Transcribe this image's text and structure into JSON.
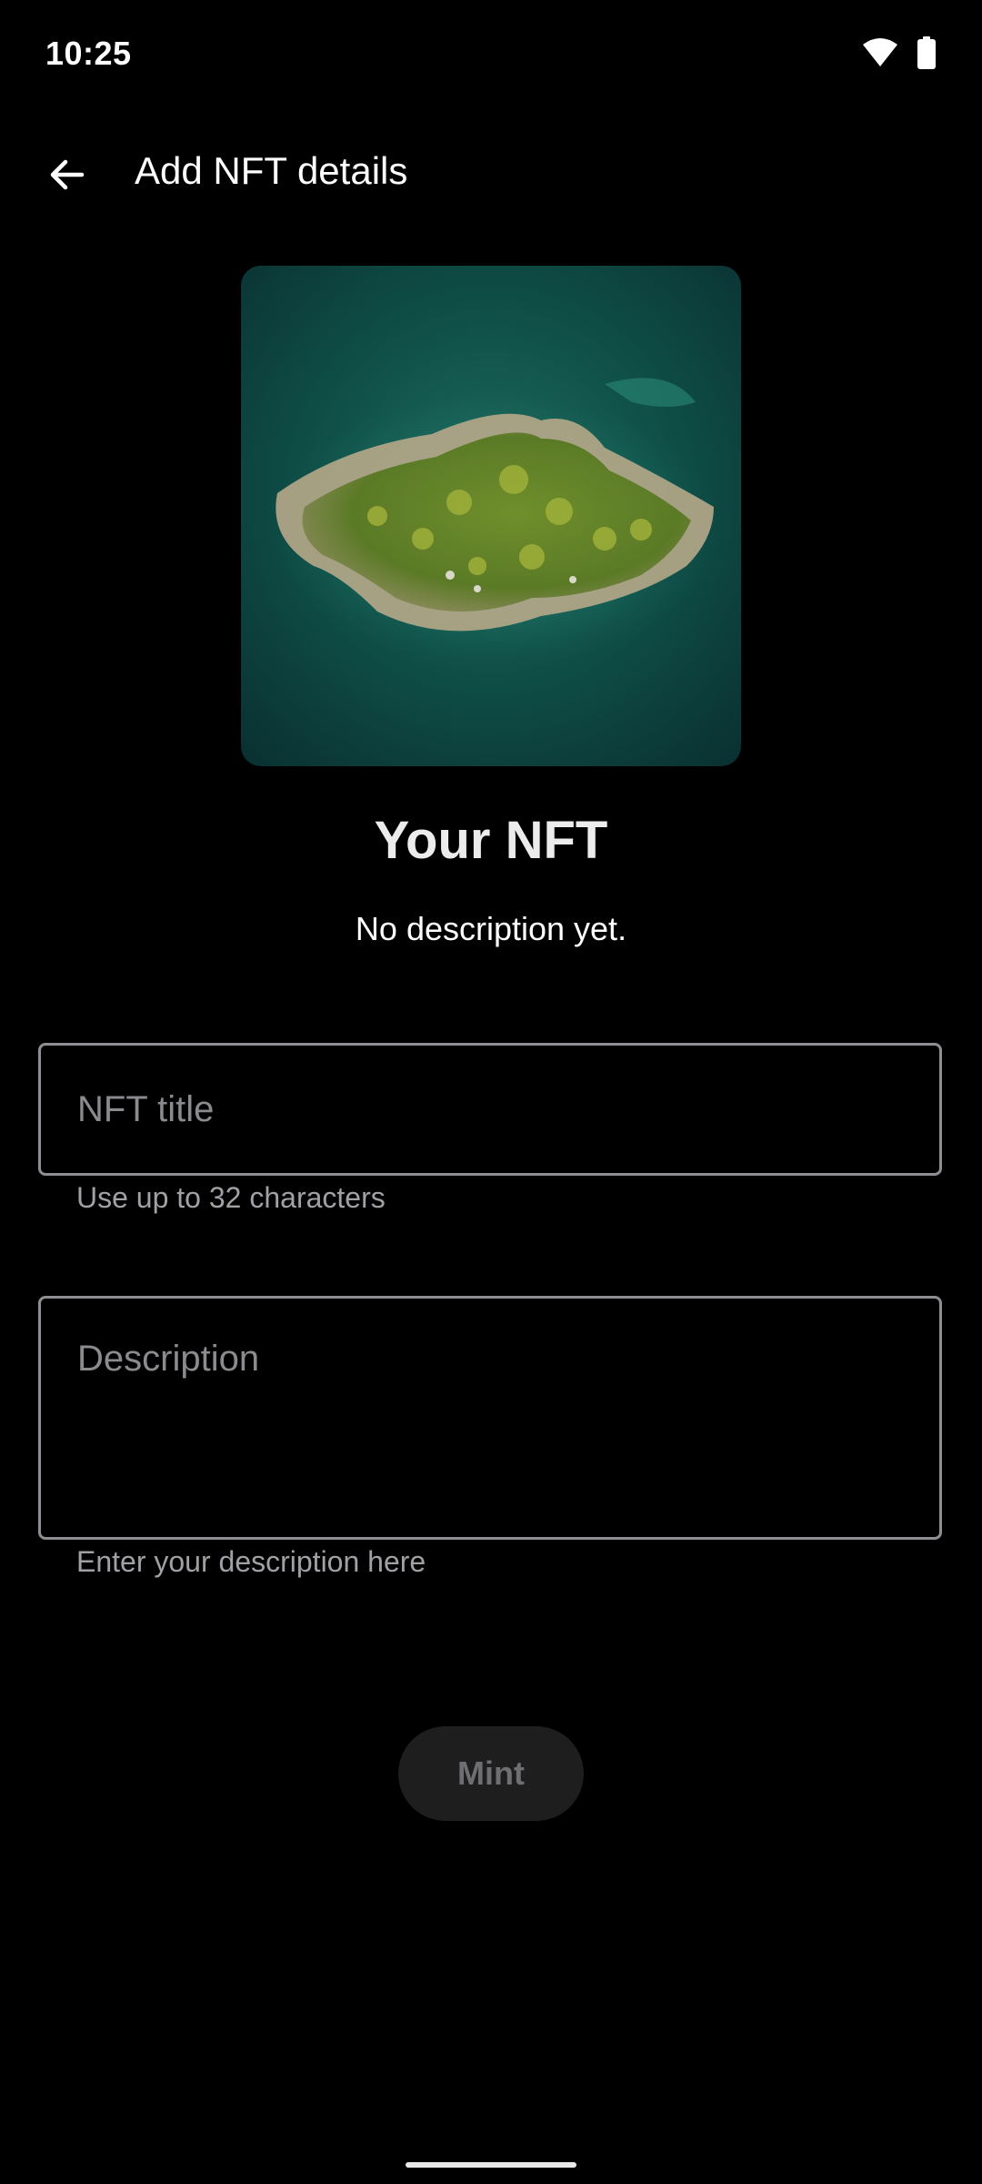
{
  "status_bar": {
    "time": "10:25",
    "icons": [
      "wifi-icon",
      "battery-icon"
    ]
  },
  "app_bar": {
    "title": "Add NFT details",
    "back_icon": "arrow-back-icon"
  },
  "preview": {
    "image_description_icon": "nft-island-image",
    "title": "Your NFT",
    "description": "No description yet."
  },
  "form": {
    "title_field": {
      "placeholder": "NFT title",
      "value": "",
      "helper": "Use up to 32 characters"
    },
    "description_field": {
      "placeholder": "Description",
      "value": "",
      "helper": "Enter your description here"
    }
  },
  "actions": {
    "mint_label": "Mint",
    "mint_enabled": false
  },
  "colors": {
    "background": "#000000",
    "outline": "#8e8e93",
    "helper_text": "#a0a0a5",
    "disabled_button_bg": "#1e1e1e",
    "disabled_button_text": "#6f6f73"
  }
}
